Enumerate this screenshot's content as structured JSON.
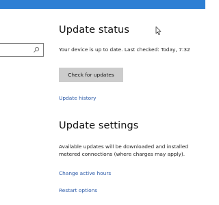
{
  "window": {
    "accent_color": "#2d7fd4"
  },
  "search": {
    "value": "",
    "placeholder": "",
    "icon": "search-icon"
  },
  "update_status": {
    "heading": "Update status",
    "status_line": "Your device is up to date. Last checked: Today, 7:32",
    "check_button_label": "Check for updates",
    "history_link": "Update history"
  },
  "update_settings": {
    "heading": "Update settings",
    "info_line1": "Available updates will be downloaded and installed",
    "info_line2": "metered connections (where charges may apply).",
    "active_hours_link": "Change active hours",
    "restart_options_link": "Restart options"
  },
  "colors": {
    "link": "#2b5aa8",
    "button_bg": "#cccccc",
    "title_bar": "#2d7fd4"
  }
}
